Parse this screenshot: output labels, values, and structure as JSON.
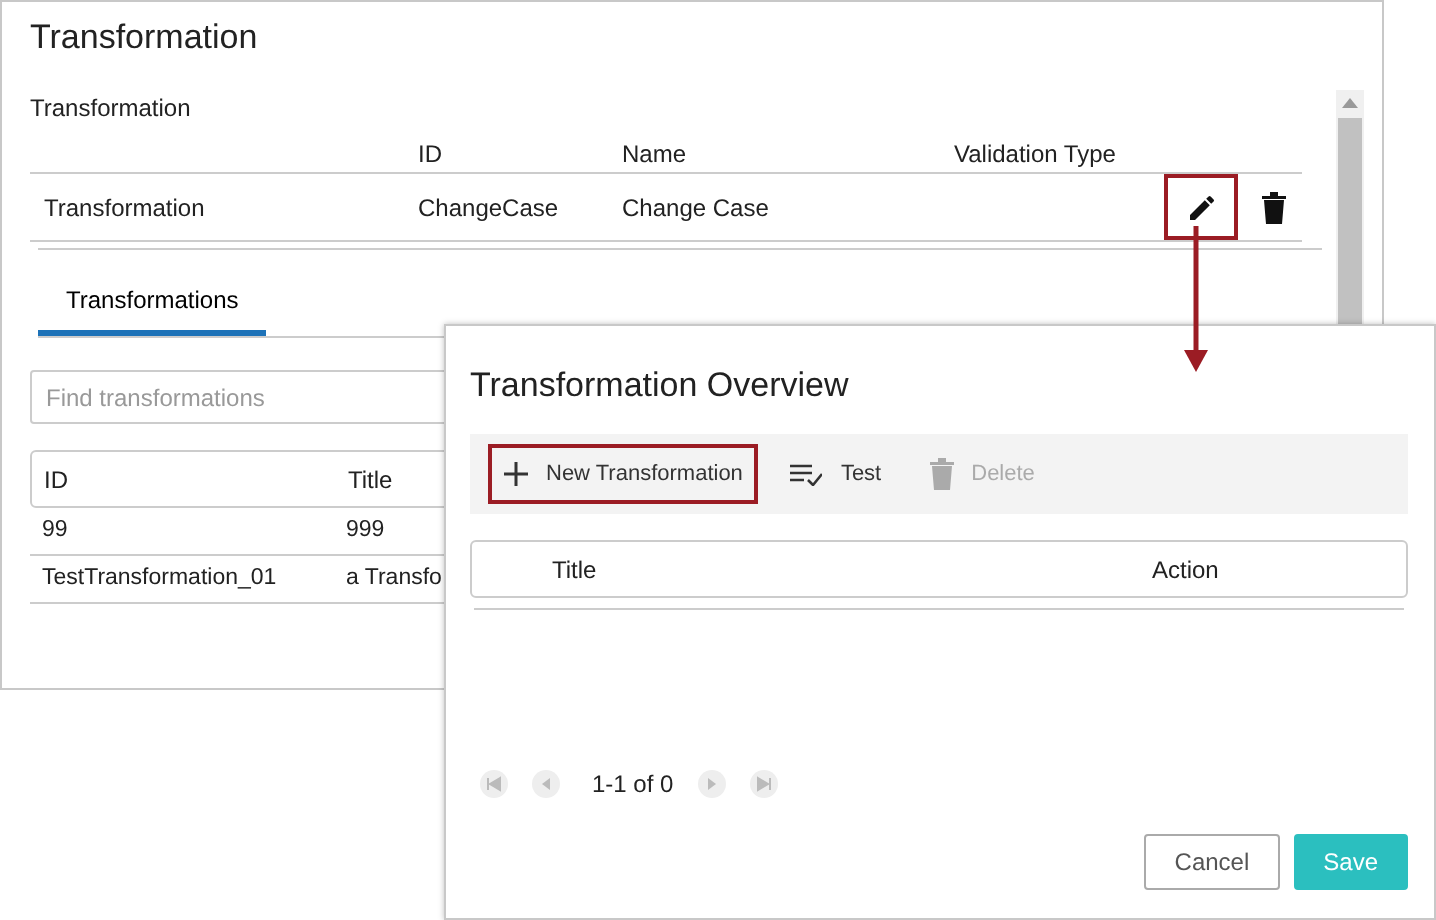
{
  "main_window": {
    "title": "Transformation",
    "section_label": "Transformation",
    "columns": [
      "",
      "ID",
      "Name",
      "Validation Type"
    ],
    "rows": [
      {
        "cells": [
          "Transformation",
          "ChangeCase",
          "Change Case"
        ],
        "edit_highlighted": true
      }
    ],
    "tabs": [
      {
        "label": "Transformations",
        "selected": true
      }
    ],
    "search": {
      "placeholder": "Find transformations"
    },
    "list_columns": [
      "ID",
      "Title"
    ],
    "list_rows": [
      [
        "99",
        "999"
      ],
      [
        "TestTransformation_01",
        "a Transfo"
      ]
    ]
  },
  "dialog": {
    "title": "Transformation Overview",
    "toolbar": [
      {
        "kind": "plus",
        "label": "New Transformation",
        "disabled": false,
        "highlighted": true
      },
      {
        "kind": "test",
        "label": "Test",
        "disabled": false,
        "highlighted": false
      },
      {
        "kind": "delete",
        "label": "Delete",
        "disabled": true,
        "highlighted": false
      }
    ],
    "columns": [
      "Title",
      "Action"
    ],
    "pager": "1-1 of 0",
    "buttons": [
      {
        "kind": "secondary",
        "label": "Cancel"
      },
      {
        "kind": "primary",
        "label": "Save"
      }
    ]
  }
}
